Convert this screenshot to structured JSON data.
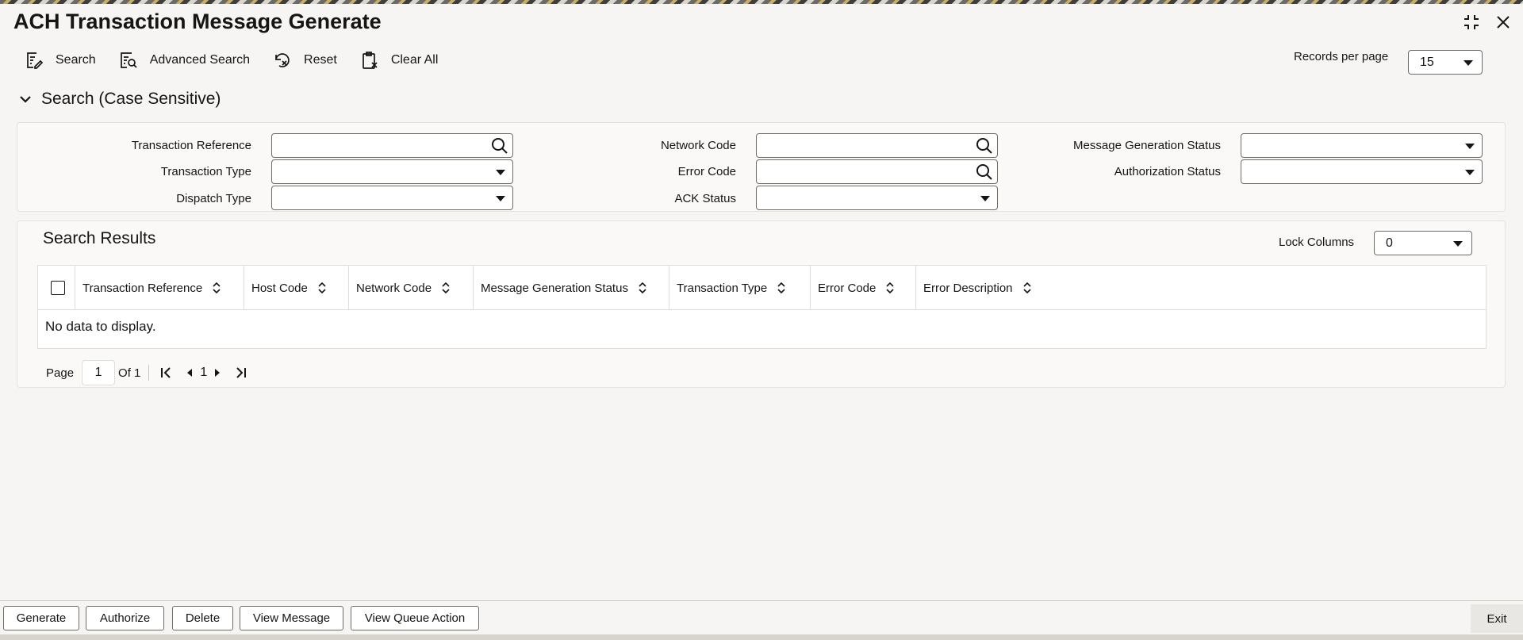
{
  "window": {
    "title": "ACH Transaction Message Generate"
  },
  "toolbar": {
    "search_label": "Search",
    "advanced_search_label": "Advanced Search",
    "reset_label": "Reset",
    "clear_all_label": "Clear All",
    "records_per_page_label": "Records per page",
    "records_per_page_value": "15"
  },
  "search_section": {
    "title": "Search (Case Sensitive)",
    "fields": {
      "transaction_reference": {
        "label": "Transaction Reference",
        "value": ""
      },
      "transaction_type": {
        "label": "Transaction Type",
        "value": ""
      },
      "dispatch_type": {
        "label": "Dispatch Type",
        "value": ""
      },
      "network_code": {
        "label": "Network Code",
        "value": ""
      },
      "error_code": {
        "label": "Error Code",
        "value": ""
      },
      "ack_status": {
        "label": "ACK Status",
        "value": ""
      },
      "message_generation_status": {
        "label": "Message Generation Status",
        "value": ""
      },
      "authorization_status": {
        "label": "Authorization Status",
        "value": ""
      }
    }
  },
  "results": {
    "title": "Search Results",
    "lock_columns_label": "Lock Columns",
    "lock_columns_value": "0",
    "columns": [
      "Transaction Reference",
      "Host Code",
      "Network Code",
      "Message Generation Status",
      "Transaction Type",
      "Error Code",
      "Error Description"
    ],
    "empty_text": "No data to display.",
    "pager": {
      "page_label": "Page",
      "current_page": "1",
      "of_label": "Of 1",
      "page_number": "1"
    }
  },
  "footer": {
    "generate_label": "Generate",
    "authorize_label": "Authorize",
    "delete_label": "Delete",
    "view_message_label": "View Message",
    "view_queue_action_label": "View Queue Action",
    "exit_label": "Exit"
  },
  "colors": {
    "background": "#f6f5f3",
    "text": "#161513",
    "border": "#6f6c67"
  }
}
